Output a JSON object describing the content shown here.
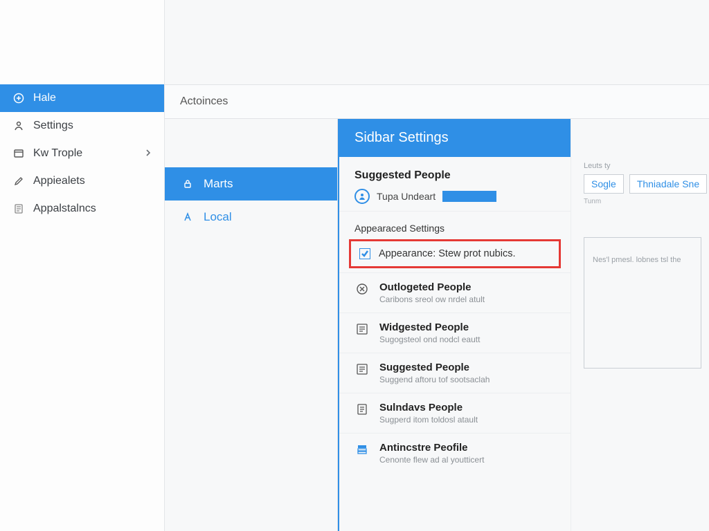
{
  "colors": {
    "accent": "#2f8fe6",
    "highlight_border": "#e53935"
  },
  "sidebar": {
    "items": [
      {
        "label": "Hale",
        "icon": "plus-circle-icon",
        "active": true
      },
      {
        "label": "Settings",
        "icon": "user-icon"
      },
      {
        "label": "Kw Trople",
        "icon": "card-icon",
        "chevron": true
      },
      {
        "label": "Appiealets",
        "icon": "pencil-icon"
      },
      {
        "label": "Appalstalncs",
        "icon": "note-icon"
      }
    ]
  },
  "breadcrumb": "Actoinces",
  "midnav": {
    "items": [
      {
        "label": "Marts",
        "icon": "lock-icon",
        "active": true
      },
      {
        "label": "Local",
        "icon": "a-icon"
      }
    ]
  },
  "panel": {
    "title": "Sidbar Settings",
    "suggested_heading": "Suggested People",
    "suggested_person": "Tupa Undeart",
    "appearance_subheading": "Appearaced Settings",
    "appearance_checkbox_label": "Appearance: Stew prot nubics.",
    "appearance_checked": true,
    "settings_list": [
      {
        "icon": "clock-x-icon",
        "title": "Outlogeted People",
        "sub": "Caribons sreol ow nrdel atult"
      },
      {
        "icon": "list-icon",
        "title": "Widgested People",
        "sub": "Sugogsteol ond nodcl eautt"
      },
      {
        "icon": "list-icon",
        "title": "Suggested People",
        "sub": "Suggend aftoru tof sootsaclah"
      },
      {
        "icon": "doc-icon",
        "title": "Sulndavs People",
        "sub": "Sugperd itom toldosl atault"
      },
      {
        "icon": "stack-icon",
        "title": "Antincstre Peofile",
        "sub": "Cenonte flew ad al youtticert"
      }
    ]
  },
  "aside": {
    "caption": "Leuts ty",
    "btn1": "Sogle",
    "btn2": "Thniadale Sne",
    "tiny": "Tunm",
    "preview_text": "Nes'l pmesl. lobnes tsl the"
  }
}
